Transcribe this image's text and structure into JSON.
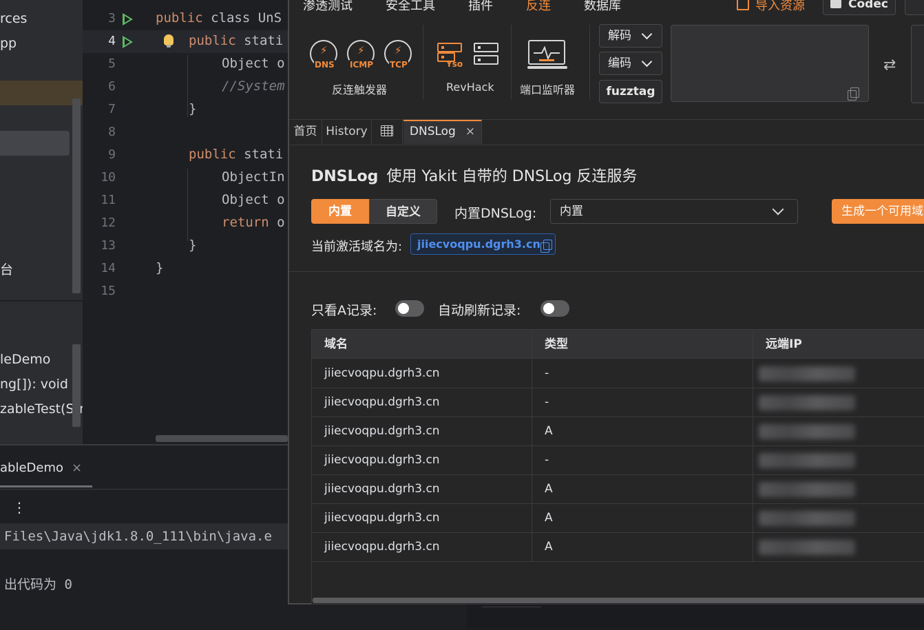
{
  "ide": {
    "tree_items": [
      "rces",
      "pp",
      "台",
      "leDemo",
      "ng[]): void",
      "zableTest(Strin"
    ],
    "line_numbers": [
      "3",
      "4",
      "5",
      "6",
      "7",
      "8",
      "9",
      "10",
      "11",
      "12",
      "13",
      "14",
      "15"
    ],
    "code_lines": {
      "l3_kw": "public",
      "l3_rest": " class UnS",
      "l4_kw": "public",
      "l4_rest": " stati",
      "l5": "Object o",
      "l6": "//System",
      "l7": "}",
      "l9_kw": "public",
      "l9_rest": " stati",
      "l10": "ObjectIn",
      "l11": "Object o",
      "l12_kw": "return",
      "l12_rest": " o",
      "l13": "}",
      "l14": "}"
    },
    "run_tab_label": "ableDemo",
    "run_tab_close": "×",
    "kebab": "⋮",
    "console_cmd": "Files\\Java\\jdk1.8.0_111\\bin\\java.e",
    "console_exit": "出代码为 0"
  },
  "yakit": {
    "menu": [
      {
        "label": "渗透测试",
        "active": false
      },
      {
        "label": "安全工具",
        "active": false
      },
      {
        "label": "插件",
        "active": false
      },
      {
        "label": "反连",
        "active": true
      },
      {
        "label": "数据库",
        "active": false
      }
    ],
    "import_label": "导入资源",
    "codec_label": "Codec",
    "tools": {
      "trigger_icons": [
        "DNS",
        "ICMP",
        "TCP"
      ],
      "trigger_label": "反连触发器",
      "yso_label": "Yso",
      "revhack_label": "RevHack",
      "port_monitor_label": "端口监听器"
    },
    "codec_buttons": {
      "decode": "解码",
      "encode": "编码",
      "fuzztag": "fuzztag"
    },
    "swap_icon": "⇄",
    "tabs": [
      {
        "label": "首页",
        "active": false
      },
      {
        "label": "History",
        "active": false
      },
      {
        "label": "",
        "active": false,
        "icon": "table-icon"
      },
      {
        "label": "DNSLog",
        "active": true,
        "close": "×"
      }
    ],
    "dnslog": {
      "title": "DNSLog",
      "subtitle": "使用 Yakit 自带的 DNSLog 反连服务",
      "seg_builtin": "内置",
      "seg_custom": "自定义",
      "builtin_label": "内置DNSLog:",
      "builtin_value": "内置",
      "generate_button": "生成一个可用域名",
      "active_domain_label": "当前激活域名为:",
      "active_domain": "jiiecvoqpu.dgrh3.cn",
      "only_a_label": "只看A记录:",
      "auto_refresh_label": "自动刷新记录:",
      "only_a_on": false,
      "auto_refresh_on": false
    },
    "table": {
      "headers": [
        "域名",
        "类型",
        "远端IP"
      ],
      "rows": [
        {
          "domain": "jiiecvoqpu.dgrh3.cn",
          "type": "-"
        },
        {
          "domain": "jiiecvoqpu.dgrh3.cn",
          "type": "-"
        },
        {
          "domain": "jiiecvoqpu.dgrh3.cn",
          "type": "A"
        },
        {
          "domain": "jiiecvoqpu.dgrh3.cn",
          "type": "-"
        },
        {
          "domain": "jiiecvoqpu.dgrh3.cn",
          "type": "A"
        },
        {
          "domain": "jiiecvoqpu.dgrh3.cn",
          "type": "A"
        },
        {
          "domain": "jiiecvoqpu.dgrh3.cn",
          "type": "A"
        }
      ]
    }
  },
  "colors": {
    "accent": "#f28b3b",
    "link": "#4f90f0",
    "ide_bg": "#1e1f22",
    "yakit_bg": "#262627"
  }
}
